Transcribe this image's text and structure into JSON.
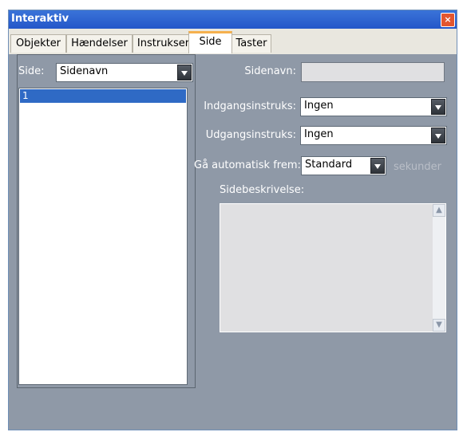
{
  "window": {
    "title": "Interaktiv",
    "close_symbol": "×"
  },
  "tabs": [
    {
      "label": "Objekter"
    },
    {
      "label": "Hændelser"
    },
    {
      "label": "Instrukser"
    },
    {
      "label": "Side"
    },
    {
      "label": "Taster"
    }
  ],
  "left": {
    "side_label": "Side:",
    "side_select_value": "Sidenavn",
    "list_items": [
      "1"
    ]
  },
  "right": {
    "sidenavn_label": "Sidenavn:",
    "sidenavn_value": "",
    "indgang_label": "Indgangsinstruks:",
    "indgang_value": "Ingen",
    "udgang_label": "Udgangsinstruks:",
    "udgang_value": "Ingen",
    "auto_label": "Gå automatisk frem:",
    "auto_value": "Standard",
    "auto_unit": "sekunder",
    "beskrivelse_label": "Sidebeskrivelse:",
    "beskrivelse_value": ""
  },
  "icons": {
    "scroll_up": "▲",
    "scroll_down": "▼"
  }
}
